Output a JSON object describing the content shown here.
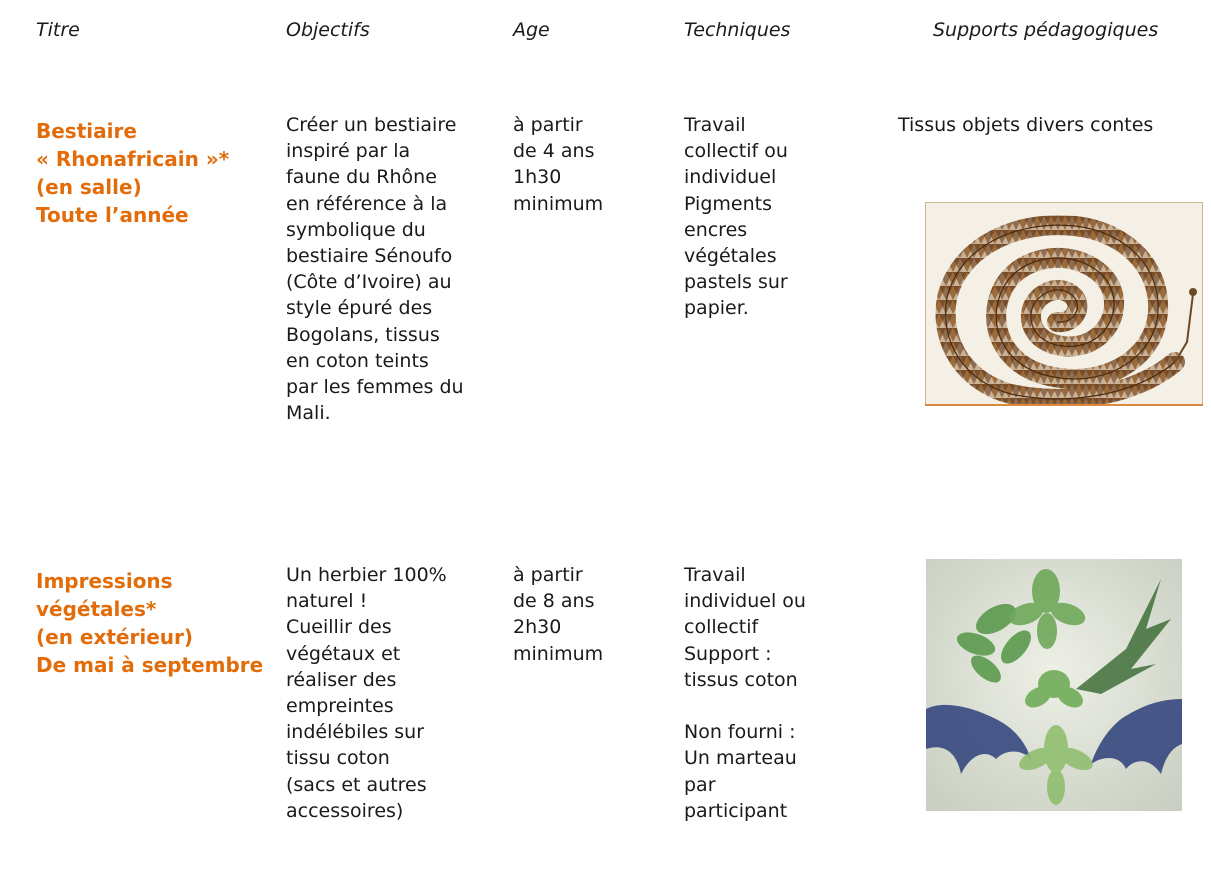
{
  "headers": {
    "titre": "Titre",
    "objectifs": "Objectifs",
    "age": "Age",
    "techniques": "Techniques",
    "supports": "Supports pédagogiques"
  },
  "rows": [
    {
      "title": [
        "Bestiaire",
        "« Rhonafricain »*",
        "(en salle)",
        "Toute l’année"
      ],
      "objectifs": [
        "Créer un bestiaire",
        "inspiré par la",
        "faune du Rhône",
        "en référence à la",
        "symbolique du",
        "bestiaire Sénoufo",
        "(Côte d’Ivoire) au",
        "style épuré des",
        "Bogolans, tissus",
        "en coton teints",
        "par les femmes du",
        "Mali."
      ],
      "age": [
        "à partir",
        "de 4 ans",
        "1h30",
        "minimum"
      ],
      "techniques": [
        "Travail",
        "collectif ou",
        "individuel",
        "Pigments",
        "encres",
        "végétales",
        "pastels sur",
        "papier."
      ],
      "supports": [
        "Tissus objets divers contes"
      ],
      "image": "spiral-serpent-drawing"
    },
    {
      "title": [
        "Impressions",
        "végétales*",
        "(en extérieur)",
        "De mai à septembre"
      ],
      "objectifs": [
        "Un herbier 100%",
        "naturel !",
        "Cueillir des",
        "végétaux et",
        "réaliser des",
        "empreintes",
        "indélébiles sur",
        "tissu coton",
        "(sacs et  autres",
        "accessoires)"
      ],
      "age": [
        "à partir",
        "de  8 ans",
        "2h30",
        "minimum"
      ],
      "techniques": [
        "Travail",
        "individuel ou",
        "collectif",
        "Support :",
        "tissus coton",
        "",
        "Non fourni :",
        "Un marteau",
        "par",
        "participant"
      ],
      "supports": [],
      "image": "leaf-print-on-fabric"
    }
  ]
}
